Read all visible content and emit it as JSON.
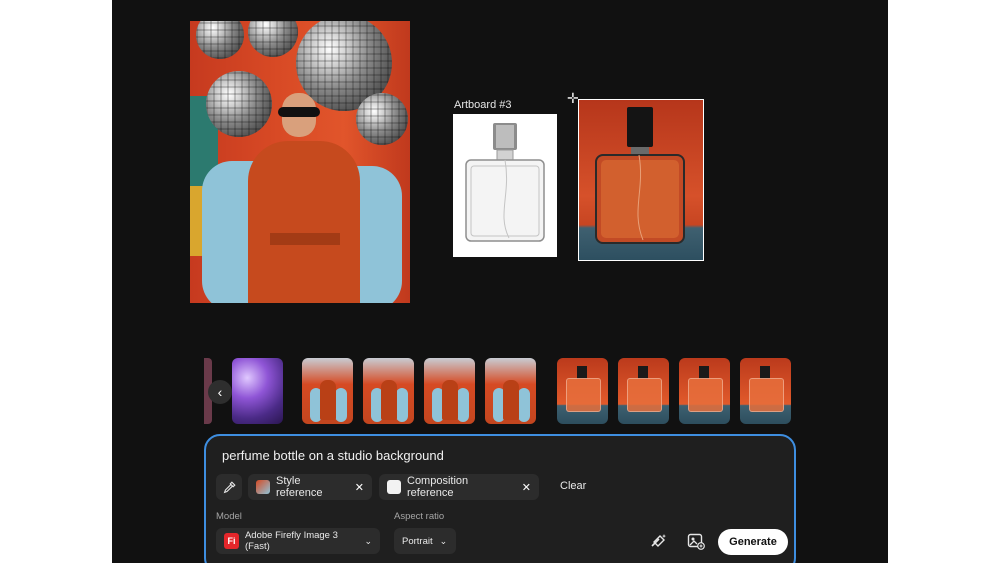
{
  "canvas": {
    "artboard_label": "Artboard #3"
  },
  "thumbnails": [
    {
      "name": "thumb-disco-ball",
      "kind": "purple"
    },
    {
      "name": "thumb-fashion-1",
      "kind": "fashion"
    },
    {
      "name": "thumb-fashion-2",
      "kind": "fashion"
    },
    {
      "name": "thumb-fashion-3",
      "kind": "fashion"
    },
    {
      "name": "thumb-fashion-4",
      "kind": "fashion"
    },
    {
      "name": "thumb-perfume-1",
      "kind": "perfume"
    },
    {
      "name": "thumb-perfume-2",
      "kind": "perfume"
    },
    {
      "name": "thumb-perfume-3",
      "kind": "perfume"
    },
    {
      "name": "thumb-perfume-4",
      "kind": "perfume"
    }
  ],
  "prompt": {
    "text": "perfume bottle on a studio background",
    "style_reference_label": "Style reference",
    "composition_reference_label": "Composition reference",
    "clear_label": "Clear",
    "model_label": "Model",
    "model_value": "Adobe Firefly Image 3 (Fast)",
    "model_logo": "Fi",
    "aspect_label": "Aspect ratio",
    "aspect_value": "Portrait",
    "generate_label": "Generate"
  },
  "icons": {
    "eyedropper": "eyedropper-icon",
    "remove": "close-icon",
    "dropdown": "chevron-down-icon",
    "prev": "chevron-left-icon",
    "effects": "wand-icon",
    "reference": "image-reference-icon"
  },
  "colors": {
    "accent": "#3e8ee0",
    "firefly_red": "#e5262b",
    "panel_bg": "#1f1f1f",
    "canvas_bg": "#111111"
  }
}
